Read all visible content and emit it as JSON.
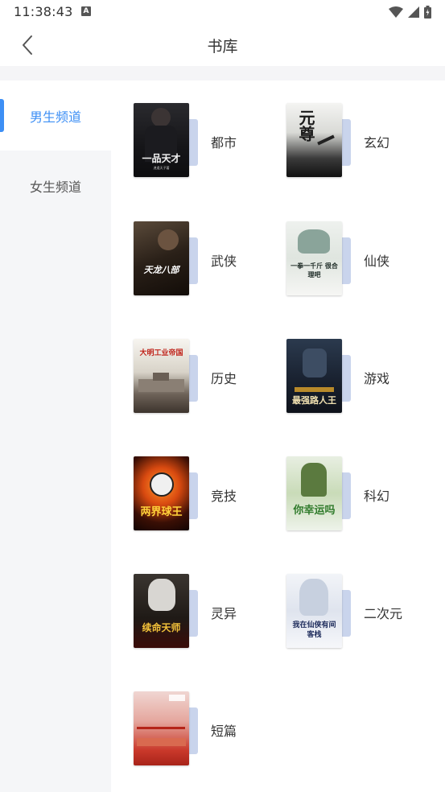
{
  "status_bar": {
    "time": "11:38:43",
    "notification_icon": "A"
  },
  "header": {
    "title": "书库"
  },
  "sidebar": {
    "tabs": [
      {
        "label": "男生频道",
        "active": true
      },
      {
        "label": "女生频道",
        "active": false
      }
    ]
  },
  "categories": [
    {
      "label": "都市",
      "cover_title": "一品天才",
      "cover_sub": "逍遥天子著"
    },
    {
      "label": "玄幻",
      "cover_title": "元尊",
      "cover_sub": ""
    },
    {
      "label": "武侠",
      "cover_title": "天龙八部",
      "cover_sub": ""
    },
    {
      "label": "仙侠",
      "cover_title": "一拳一千斤 很合理吧",
      "cover_sub": ""
    },
    {
      "label": "历史",
      "cover_title": "大明工业帝国",
      "cover_sub": ""
    },
    {
      "label": "游戏",
      "cover_title": "最强路人王",
      "cover_sub": ""
    },
    {
      "label": "竞技",
      "cover_title": "两界球王",
      "cover_sub": ""
    },
    {
      "label": "科幻",
      "cover_title": "你幸运吗",
      "cover_sub": ""
    },
    {
      "label": "灵异",
      "cover_title": "续命天师",
      "cover_sub": ""
    },
    {
      "label": "二次元",
      "cover_title": "我在仙侠有间客栈",
      "cover_sub": ""
    },
    {
      "label": "短篇",
      "cover_title": "",
      "cover_sub": ""
    }
  ],
  "colors": {
    "accent": "#3d8ff5",
    "sidebar_bg": "#f5f6f8",
    "cover_shadow": "#c9d4ec"
  }
}
